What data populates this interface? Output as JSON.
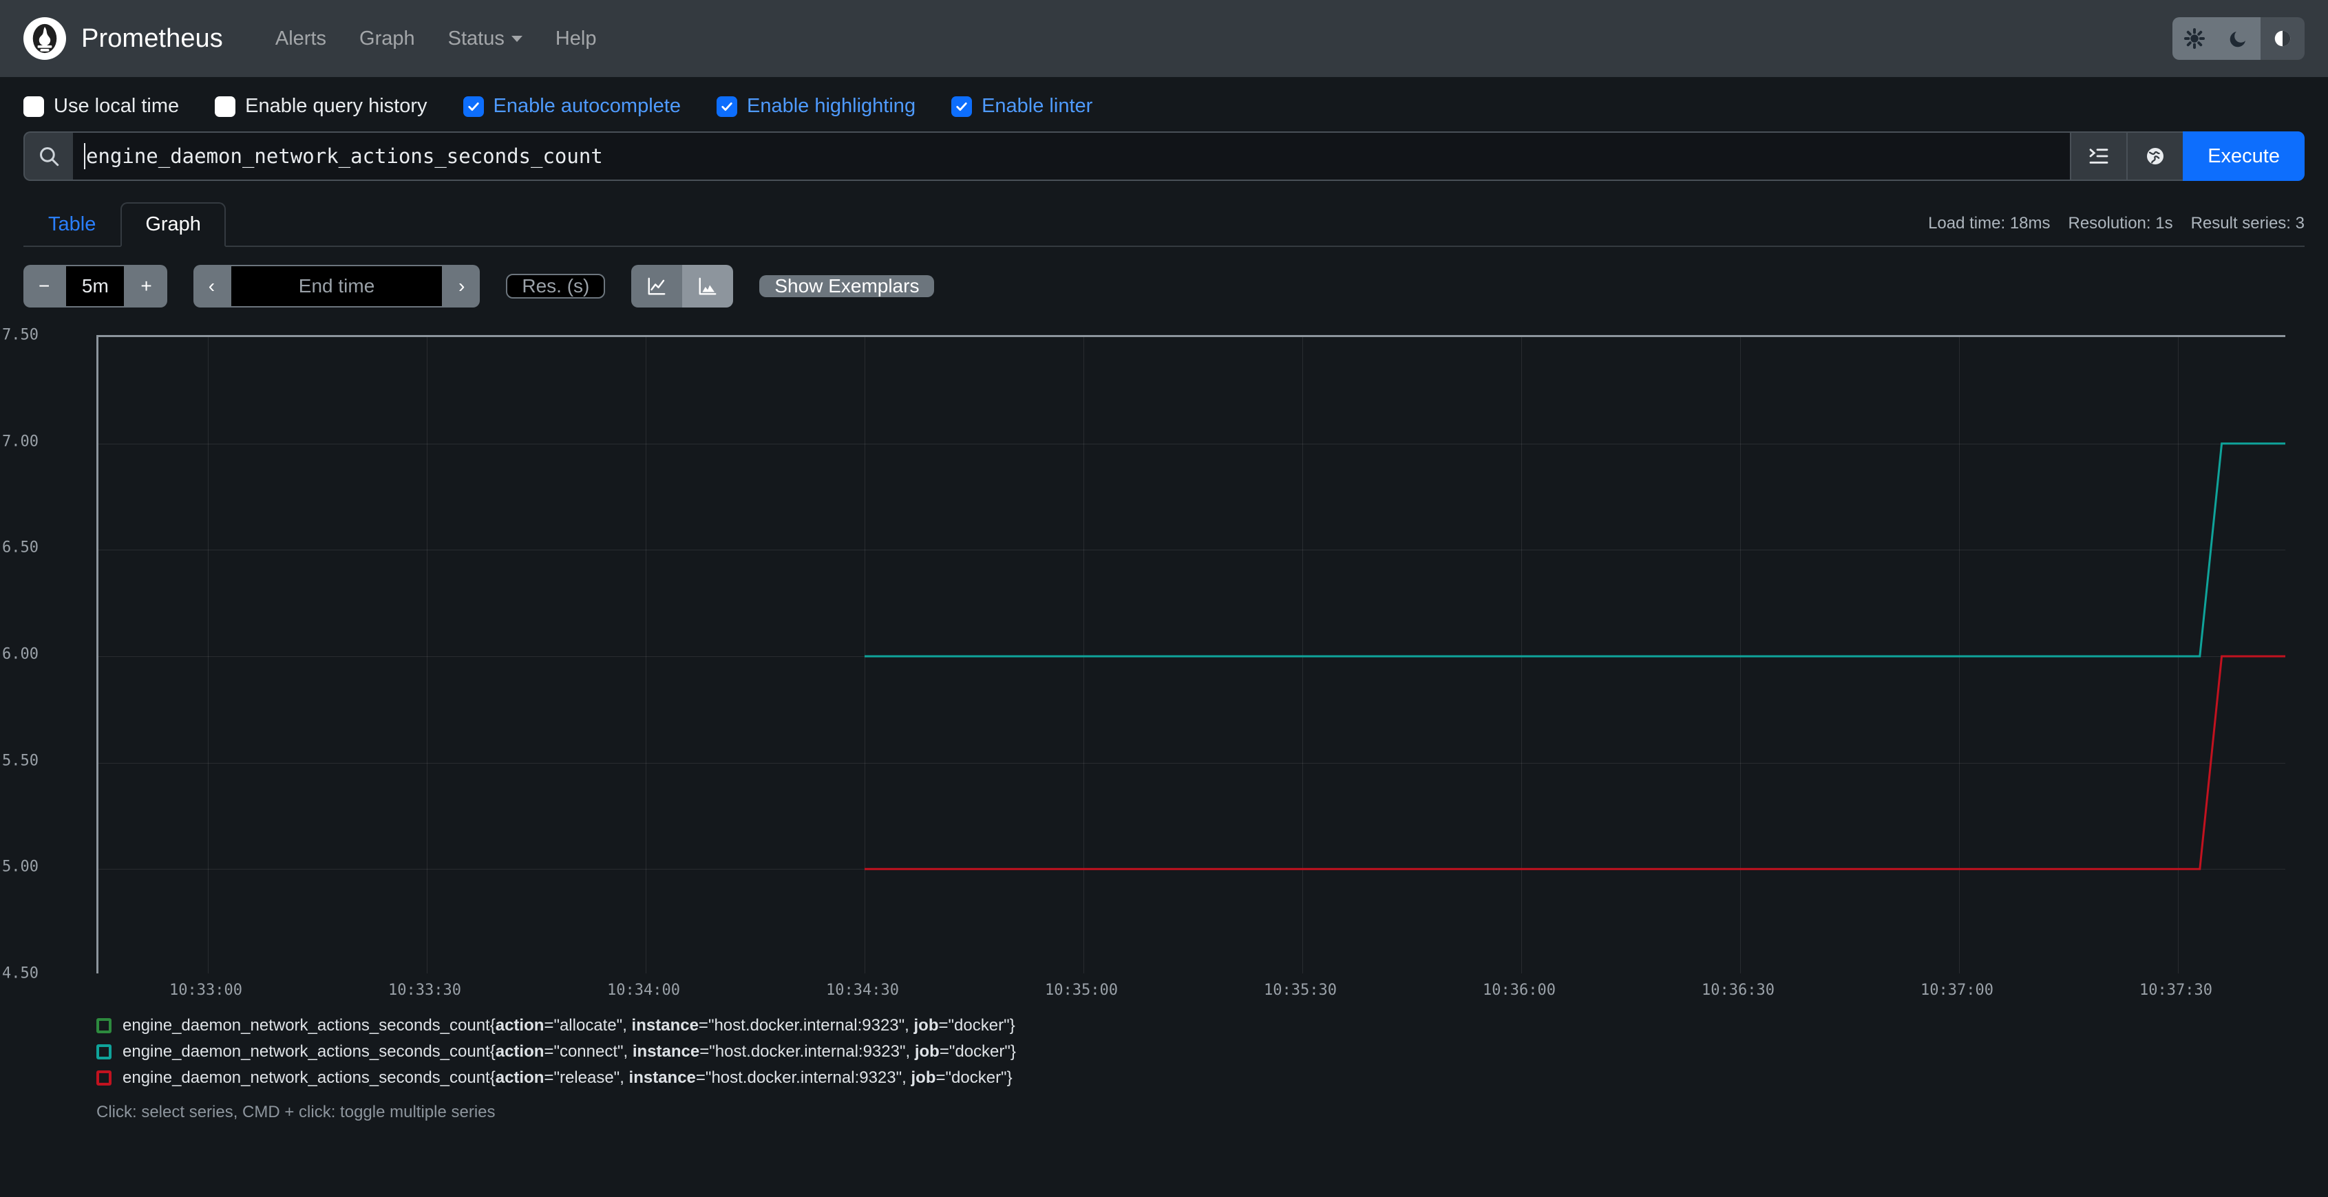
{
  "navbar": {
    "brand": "Prometheus",
    "logo_icon": "prometheus-logo-icon",
    "links": [
      {
        "label": "Alerts",
        "name": "nav-link-alerts",
        "caret": false
      },
      {
        "label": "Graph",
        "name": "nav-link-graph",
        "caret": false
      },
      {
        "label": "Status",
        "name": "nav-link-status",
        "caret": true
      },
      {
        "label": "Help",
        "name": "nav-link-help",
        "caret": false
      }
    ],
    "theme_buttons": [
      {
        "icon": "sun-icon",
        "name": "theme-light-button",
        "active": false
      },
      {
        "icon": "moon-icon",
        "name": "theme-dark-button",
        "active": false
      },
      {
        "icon": "half-circle-icon",
        "name": "theme-auto-button",
        "active": true
      }
    ]
  },
  "options": [
    {
      "label": "Use local time",
      "checked": false
    },
    {
      "label": "Enable query history",
      "checked": false
    },
    {
      "label": "Enable autocomplete",
      "checked": true
    },
    {
      "label": "Enable highlighting",
      "checked": true
    },
    {
      "label": "Enable linter",
      "checked": true
    }
  ],
  "query": {
    "search_icon": "search-icon",
    "value": "engine_daemon_network_actions_seconds_count",
    "format_icon": "indent-format-icon",
    "explore_icon": "globe-metrics-explorer-icon",
    "execute_label": "Execute"
  },
  "tabs": [
    {
      "label": "Table",
      "active": false
    },
    {
      "label": "Graph",
      "active": true
    }
  ],
  "stats": {
    "load_time": "Load time: 18ms",
    "resolution": "Resolution: 1s",
    "result_series": "Result series: 3"
  },
  "controls": {
    "decrease_label": "−",
    "range_value": "5m",
    "increase_label": "+",
    "prev_label": "‹",
    "end_time_placeholder": "End time",
    "next_label": "›",
    "resolution_placeholder": "Res. (s)",
    "line_chart_icon": "line-chart-icon",
    "stacked_chart_icon": "stacked-area-chart-icon",
    "show_exemplars_label": "Show Exemplars"
  },
  "legend": [
    {
      "color": "#2d8a3e",
      "metric": "engine_daemon_network_actions_seconds_count{",
      "labels": [
        {
          "key": "action",
          "value": "\"allocate\""
        },
        {
          "key": "instance",
          "value": "\"host.docker.internal:9323\""
        },
        {
          "key": "job",
          "value": "\"docker\""
        }
      ]
    },
    {
      "color": "#0fa39a",
      "metric": "engine_daemon_network_actions_seconds_count{",
      "labels": [
        {
          "key": "action",
          "value": "\"connect\""
        },
        {
          "key": "instance",
          "value": "\"host.docker.internal:9323\""
        },
        {
          "key": "job",
          "value": "\"docker\""
        }
      ]
    },
    {
      "color": "#c1121f",
      "metric": "engine_daemon_network_actions_seconds_count{",
      "labels": [
        {
          "key": "action",
          "value": "\"release\""
        },
        {
          "key": "instance",
          "value": "\"host.docker.internal:9323\""
        },
        {
          "key": "job",
          "value": "\"docker\""
        }
      ]
    }
  ],
  "hint": "Click: select series, CMD + click: toggle multiple series",
  "chart_data": {
    "type": "line",
    "title": "",
    "xlabel": "",
    "ylabel": "",
    "grid": true,
    "legend_position": "bottom",
    "ylim": [
      4.5,
      7.5
    ],
    "yticks": [
      7.5,
      7.0,
      6.5,
      6.0,
      5.5,
      5.0,
      4.5
    ],
    "ytick_labels": [
      "7.50",
      "7.00",
      "6.50",
      "6.00",
      "5.50",
      "5.00",
      "4.50"
    ],
    "xticks": [
      "10:33:00",
      "10:33:30",
      "10:34:00",
      "10:34:30",
      "10:35:00",
      "10:35:30",
      "10:36:00",
      "10:36:30",
      "10:37:00",
      "10:37:30"
    ],
    "xlim": [
      "10:32:45",
      "10:37:45"
    ],
    "series": [
      {
        "name": "engine_daemon_network_actions_seconds_count{action=\"allocate\", instance=\"host.docker.internal:9323\", job=\"docker\"}",
        "color": "#2d8a3e",
        "points": []
      },
      {
        "name": "engine_daemon_network_actions_seconds_count{action=\"connect\", instance=\"host.docker.internal:9323\", job=\"docker\"}",
        "color": "#0fa39a",
        "points": [
          {
            "x": "10:34:30",
            "y": 6.0
          },
          {
            "x": "10:37:33",
            "y": 6.0
          },
          {
            "x": "10:37:36",
            "y": 7.0
          },
          {
            "x": "10:37:45",
            "y": 7.0
          }
        ]
      },
      {
        "name": "engine_daemon_network_actions_seconds_count{action=\"release\", instance=\"host.docker.internal:9323\", job=\"docker\"}",
        "color": "#c1121f",
        "points": [
          {
            "x": "10:34:30",
            "y": 5.0
          },
          {
            "x": "10:37:33",
            "y": 5.0
          },
          {
            "x": "10:37:36",
            "y": 6.0
          },
          {
            "x": "10:37:45",
            "y": 6.0
          }
        ]
      }
    ]
  }
}
